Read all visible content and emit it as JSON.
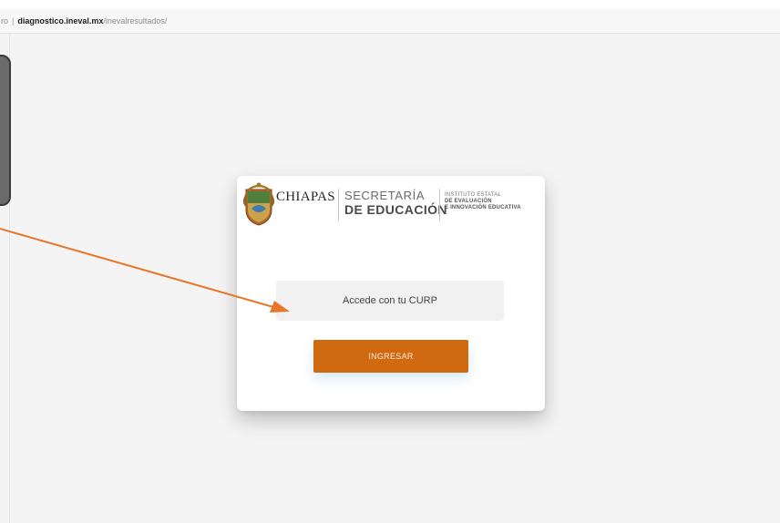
{
  "browser": {
    "address_prefix": "ro",
    "url_domain": "diagnostico.ineval.mx",
    "url_path": "/inevalresultados/"
  },
  "logos": {
    "chiapas": "CHIAPAS",
    "secretaria_line1": "SECRETARÍA",
    "secretaria_line2": "DE EDUCACIÓN",
    "instituto_line1": "INSTITUTO ESTATAL",
    "instituto_line2": "DE EVALUACIÓN",
    "instituto_line3": "E INNOVACIÓN EDUCATIVA"
  },
  "login": {
    "curp_placeholder": "Accede con tu CURP",
    "submit_label": "INGRESAR"
  },
  "colors": {
    "accent": "#cf6a11",
    "annotation_arrow": "#e8762b"
  },
  "icons": {
    "coat_of_arms": "chiapas-coat-of-arms-icon",
    "annotation": "arrow-annotation-icon"
  }
}
